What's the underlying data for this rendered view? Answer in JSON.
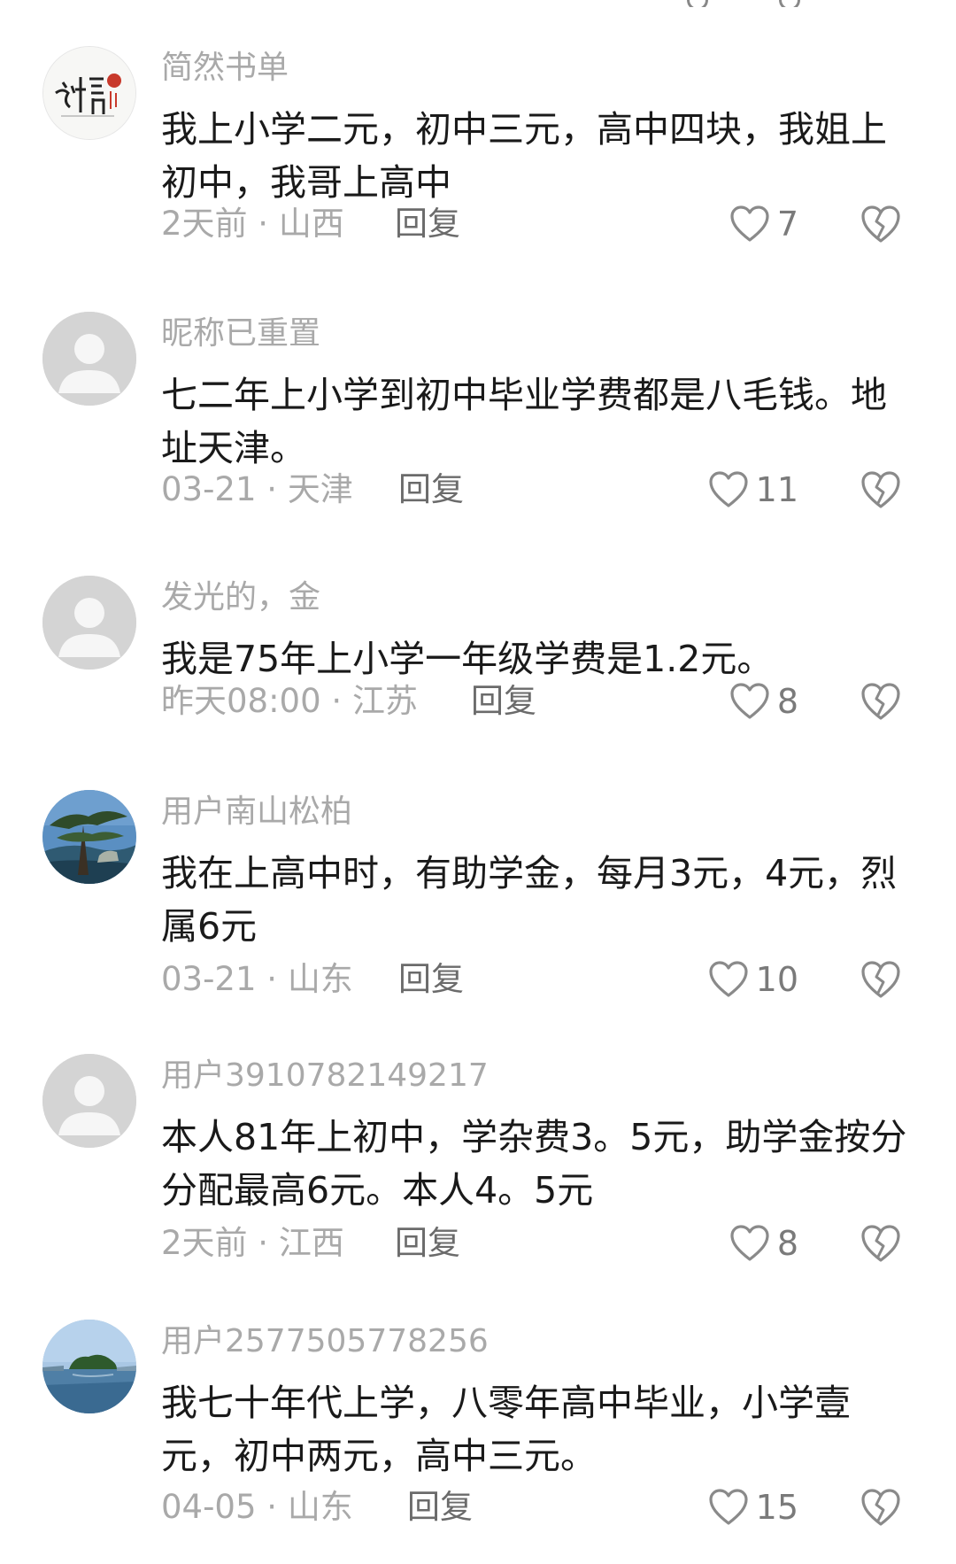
{
  "comments": [
    {
      "username": "简然书单",
      "text": "我上小学二元，初中三元，高中四块，我姐上初中，我哥上高中",
      "time": "2天前",
      "region": "山西",
      "reply": "回复",
      "likes": "7",
      "avatar": "calligraphy"
    },
    {
      "username": "昵称已重置",
      "text": "七二年上小学到初中毕业学费都是八毛钱。地址天津。",
      "time": "03-21",
      "region": "天津",
      "reply": "回复",
      "likes": "11",
      "avatar": "default"
    },
    {
      "username": "发光的，金",
      "text": "我是75年上小学一年级学费是1.2元。",
      "time": "昨天08:00",
      "region": "江苏",
      "reply": "回复",
      "likes": "8",
      "avatar": "default"
    },
    {
      "username": "用户南山松柏",
      "text": "我在上高中时，有助学金，每月3元，4元，烈属6元",
      "time": "03-21",
      "region": "山东",
      "reply": "回复",
      "likes": "10",
      "avatar": "pine"
    },
    {
      "username": "用户3910782149217",
      "text": "本人81年上初中，学杂费3。5元，助学金按分分配最高6元。本人4。5元",
      "time": "2天前",
      "region": "江西",
      "reply": "回复",
      "likes": "8",
      "avatar": "default"
    },
    {
      "username": "用户2577505778256",
      "text": "我七十年代上学，八零年高中毕业，小学壹元，初中两元，高中三元。",
      "time": "04-05",
      "region": "山东",
      "reply": "回复",
      "likes": "15",
      "avatar": "lake"
    }
  ],
  "separator": " · ",
  "icons": {
    "like": "heart-outline-icon",
    "dislike": "broken-heart-icon",
    "default_avatar": "default-avatar-icon"
  },
  "colors": {
    "username": "#a9a9a9",
    "text": "#1a1a1a",
    "meta": "#a9a9a9",
    "reply": "#6b6b6b"
  }
}
